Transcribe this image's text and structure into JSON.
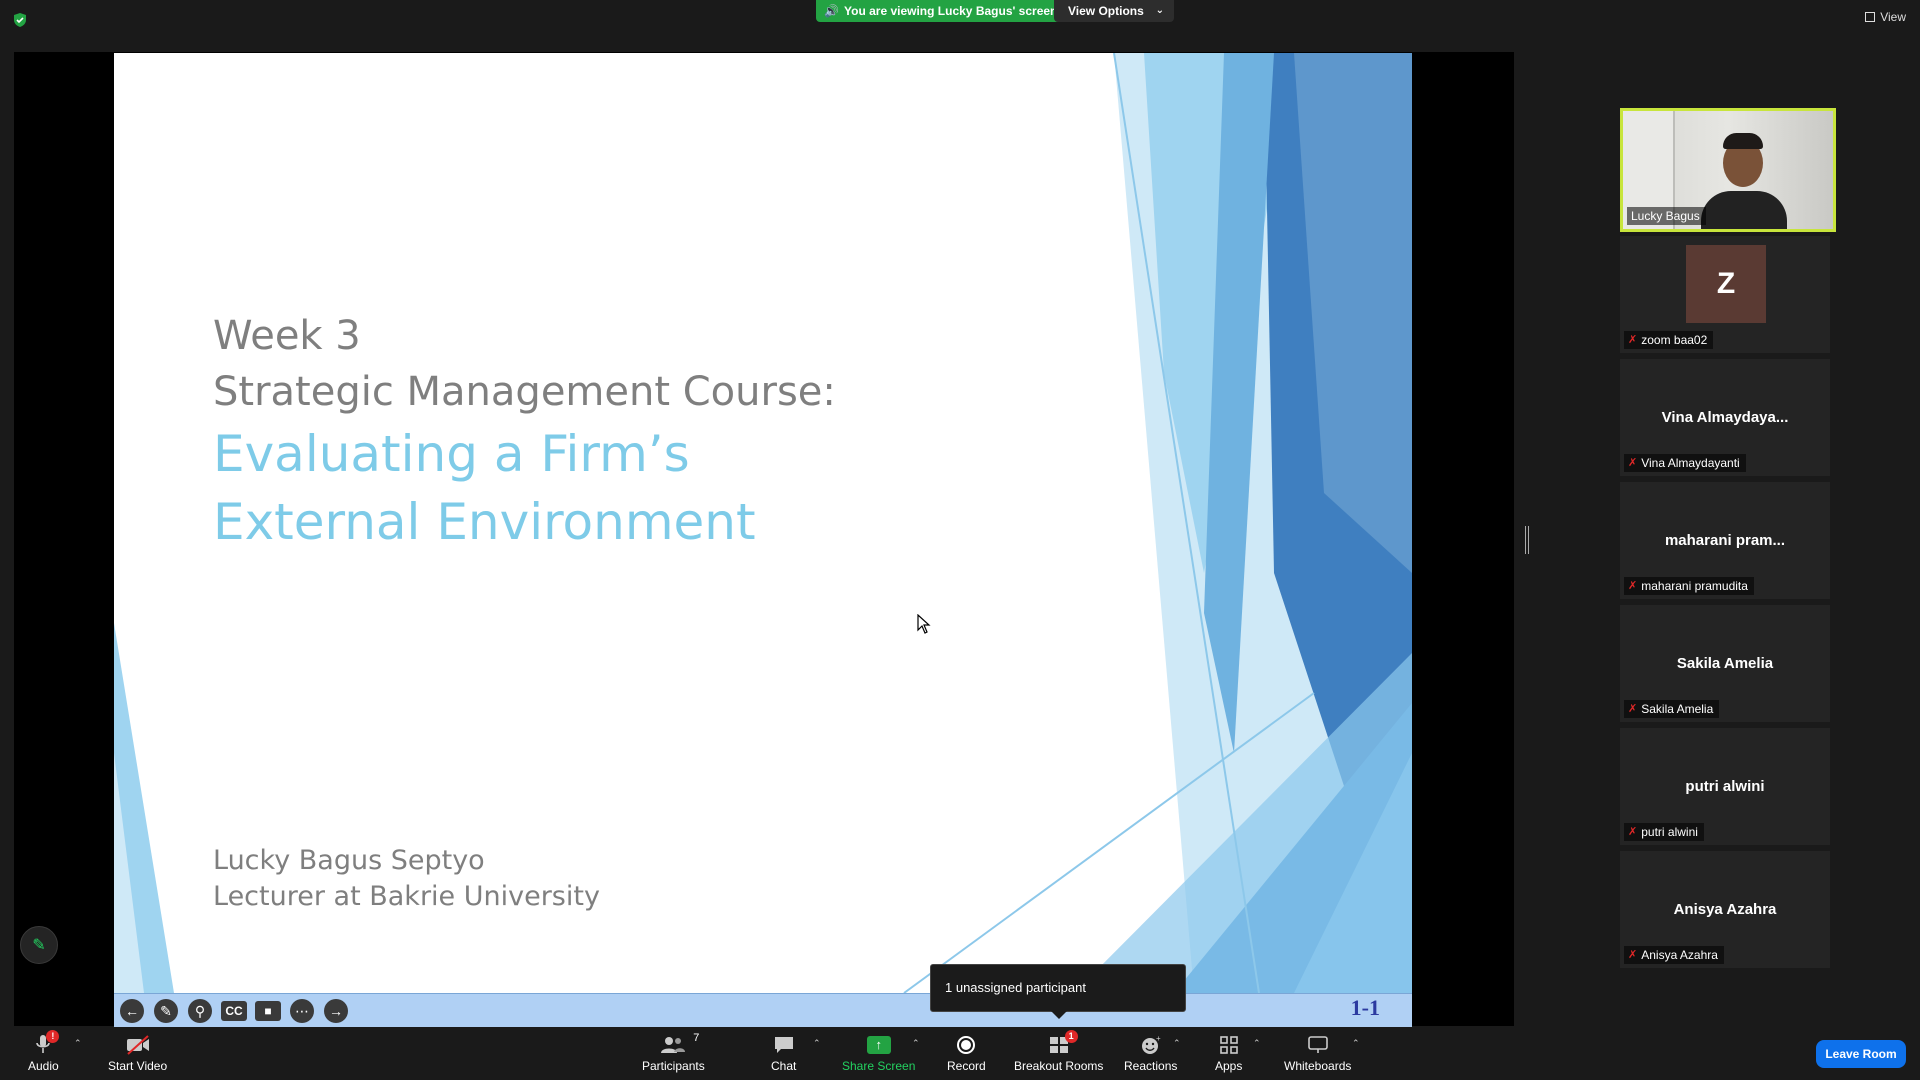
{
  "top": {
    "viewing_text": "You are viewing Lucky Bagus' screen",
    "view_options_label": "View Options",
    "view_label": "View"
  },
  "slide": {
    "line1": "Week 3",
    "line2": "Strategic Management Course:",
    "line3": "Evaluating a Firm’s",
    "line4": "External Environment",
    "author_line1": "Lucky Bagus Septyo",
    "author_line2": "Lecturer at Bakrie University",
    "slide_number": "1-1",
    "accent_color": "#7ecbe8"
  },
  "tooltip": {
    "text": "1 unassigned participant"
  },
  "participants": {
    "active_speaker": "Lucky Bagus",
    "tiles": [
      {
        "center": "",
        "avatar_letter": "Z",
        "label": "zoom baa02"
      },
      {
        "center": "Vina  Almaydaya...",
        "label": "Vina Almaydayanti"
      },
      {
        "center": "maharani  pram...",
        "label": "maharani pramudita"
      },
      {
        "center": "Sakila Amelia",
        "label": "Sakila Amelia"
      },
      {
        "center": "putri alwini",
        "label": "putri alwini"
      },
      {
        "center": "Anisya Azahra",
        "label": "Anisya Azahra"
      }
    ]
  },
  "toolbar": {
    "audio": "Audio",
    "audio_badge": "!",
    "start_video": "Start Video",
    "participants": "Participants",
    "participants_count": "7",
    "chat": "Chat",
    "share_screen": "Share Screen",
    "record": "Record",
    "breakout_rooms": "Breakout Rooms",
    "breakout_badge": "1",
    "reactions": "Reactions",
    "apps": "Apps",
    "whiteboards": "Whiteboards",
    "leave_room": "Leave Room"
  }
}
